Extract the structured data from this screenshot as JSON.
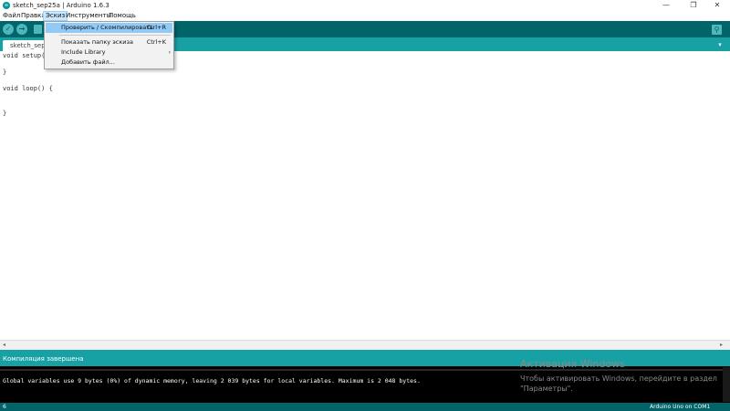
{
  "window": {
    "title": "sketch_sep25a | Arduino 1.6.3",
    "icon_text": "∞",
    "controls": {
      "minimize": "—",
      "maximize": "❐",
      "close": "✕"
    }
  },
  "menubar": {
    "items": [
      {
        "label": "Файл"
      },
      {
        "label": "Правка"
      },
      {
        "label": "Эскиз"
      },
      {
        "label": "Инструменты"
      },
      {
        "label": "Помощь"
      }
    ],
    "active_index": 2
  },
  "toolbar": {
    "verify": "✓",
    "upload": "→",
    "serial_monitor": "⚲"
  },
  "tabs": {
    "active": "sketch_sep25a",
    "menu_arrow": "▾"
  },
  "dropdown": {
    "items": [
      {
        "label": "Проверить / Скомпилировать",
        "shortcut": "Ctrl+R",
        "highlighted": true
      },
      {
        "label": "Показать папку эскиза",
        "shortcut": "Ctrl+K"
      },
      {
        "label": "Include Library",
        "submenu": "›"
      },
      {
        "label": "Добавить файл..."
      }
    ]
  },
  "editor": {
    "lines": [
      "void setup() {",
      "}",
      "void loop() {",
      "}"
    ]
  },
  "scroll": {
    "left": "◂",
    "right": "▸"
  },
  "status": {
    "message": "Компиляция завершена"
  },
  "console": {
    "text": "Global variables use 9 bytes (0%) of dynamic memory, leaving 2 039 bytes for local variables. Maximum is 2 048 bytes."
  },
  "watermark": {
    "title": "Активация Windows",
    "line1": "Чтобы активировать Windows, перейдите в раздел",
    "line2": "\"Параметры\"."
  },
  "footer": {
    "line_number": "6",
    "board": "Arduino Uno on COM1"
  },
  "colors": {
    "teal_dark": "#006468",
    "teal": "#17a1a5",
    "button": "#4db7bb",
    "menu_highlight": "#91c9f7"
  }
}
